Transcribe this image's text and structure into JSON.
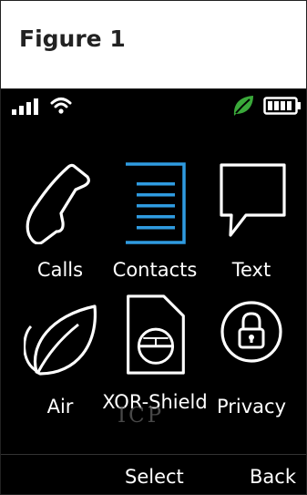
{
  "caption": {
    "title": "Figure 1"
  },
  "apps": [
    {
      "id": "calls",
      "label": "Calls",
      "icon": "phone-icon",
      "color": "#ffffff"
    },
    {
      "id": "contacts",
      "label": "Contacts",
      "icon": "contacts-list-icon",
      "color": "#2f9be0"
    },
    {
      "id": "text",
      "label": "Text",
      "icon": "speech-bubble-icon",
      "color": "#ffffff"
    },
    {
      "id": "air",
      "label": "Air",
      "icon": "leaf-icon",
      "color": "#ffffff"
    },
    {
      "id": "xor-shield",
      "label": "XOR-Shield",
      "icon": "sim-card-icon",
      "color": "#ffffff"
    },
    {
      "id": "privacy",
      "label": "Privacy",
      "icon": "lock-circle-icon",
      "color": "#ffffff"
    }
  ],
  "watermark": "ICP",
  "softkeys": {
    "left": "Select",
    "right": "Back"
  },
  "status": {
    "leaf_color": "#3aa93a",
    "battery_level": 1.0
  }
}
